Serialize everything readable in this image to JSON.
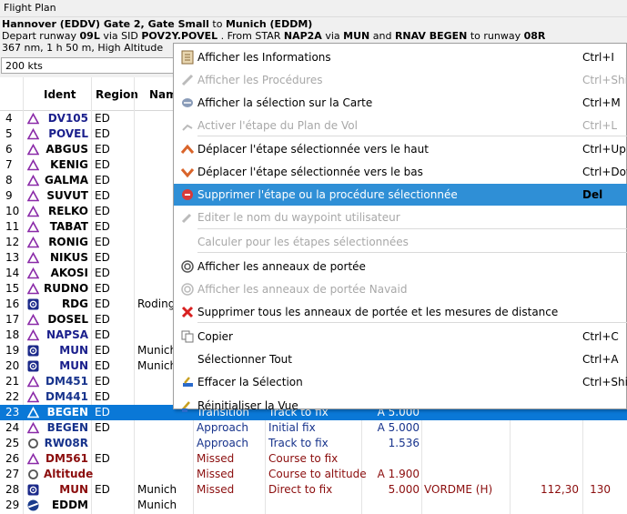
{
  "window": {
    "title": "Flight Plan"
  },
  "info": {
    "line1_from": "Hannover (EDDV) Gate 2, Gate Small",
    "line1_to_word": "to",
    "line1_to": "Munich (EDDM)",
    "line2_a": "Depart runway ",
    "line2_rw": "09L",
    "line2_b": " via SID ",
    "line2_sid": "POV2Y.POVEL",
    "line2_c": " . From STAR ",
    "line2_star": "NAP2A",
    "line2_d": " via ",
    "line2_via": "MUN",
    "line2_e": " and ",
    "line2_rnav": "RNAV BEGEN",
    "line2_f": " to runway ",
    "line2_rw2": "08R",
    "line3": "367 nm, 1 h 50 m, High Altitude"
  },
  "speed": {
    "value": "200 kts"
  },
  "table": {
    "headers": {
      "ident": "Ident",
      "region": "Region",
      "name": "Nam"
    },
    "rows": [
      {
        "num": "4",
        "icon": "triangle",
        "ident": "DV105",
        "region": "ED",
        "name": "",
        "proc": "",
        "leg": "",
        "alt": "",
        "rest": "",
        "crs": "",
        "dst": "",
        "c": "navy"
      },
      {
        "num": "5",
        "icon": "triangle",
        "ident": "POVEL",
        "region": "ED",
        "name": "",
        "proc": "",
        "leg": "",
        "alt": "",
        "rest": "",
        "crs": "",
        "dst": "",
        "c": "navy"
      },
      {
        "num": "6",
        "icon": "triangle",
        "ident": "ABGUS",
        "region": "ED",
        "name": "",
        "proc": "",
        "leg": "",
        "alt": "",
        "rest": "",
        "crs": "",
        "dst": "",
        "c": ""
      },
      {
        "num": "7",
        "icon": "triangle",
        "ident": "KENIG",
        "region": "ED",
        "name": "",
        "proc": "",
        "leg": "",
        "alt": "",
        "rest": "",
        "crs": "",
        "dst": "",
        "c": ""
      },
      {
        "num": "8",
        "icon": "triangle",
        "ident": "GALMA",
        "region": "ED",
        "name": "",
        "proc": "",
        "leg": "",
        "alt": "",
        "rest": "",
        "crs": "",
        "dst": "",
        "c": ""
      },
      {
        "num": "9",
        "icon": "triangle",
        "ident": "SUVUT",
        "region": "ED",
        "name": "",
        "proc": "",
        "leg": "",
        "alt": "",
        "rest": "",
        "crs": "",
        "dst": "",
        "c": ""
      },
      {
        "num": "10",
        "icon": "triangle",
        "ident": "RELKO",
        "region": "ED",
        "name": "",
        "proc": "",
        "leg": "",
        "alt": "",
        "rest": "",
        "crs": "",
        "dst": "",
        "c": ""
      },
      {
        "num": "11",
        "icon": "triangle",
        "ident": "TABAT",
        "region": "ED",
        "name": "",
        "proc": "",
        "leg": "",
        "alt": "",
        "rest": "",
        "crs": "",
        "dst": "",
        "c": ""
      },
      {
        "num": "12",
        "icon": "triangle",
        "ident": "RONIG",
        "region": "ED",
        "name": "",
        "proc": "",
        "leg": "",
        "alt": "",
        "rest": "",
        "crs": "",
        "dst": "",
        "c": ""
      },
      {
        "num": "13",
        "icon": "triangle",
        "ident": "NIKUS",
        "region": "ED",
        "name": "",
        "proc": "",
        "leg": "",
        "alt": "",
        "rest": "",
        "crs": "",
        "dst": "",
        "c": ""
      },
      {
        "num": "14",
        "icon": "triangle",
        "ident": "AKOSI",
        "region": "ED",
        "name": "",
        "proc": "",
        "leg": "",
        "alt": "",
        "rest": "",
        "crs": "",
        "dst": "",
        "c": ""
      },
      {
        "num": "15",
        "icon": "triangle",
        "ident": "RUDNO",
        "region": "ED",
        "name": "",
        "proc": "",
        "leg": "",
        "alt": "",
        "rest": "",
        "crs": "",
        "dst": "",
        "c": ""
      },
      {
        "num": "16",
        "icon": "vor",
        "ident": "RDG",
        "region": "ED",
        "name": "Roding",
        "proc": "",
        "leg": "",
        "alt": "",
        "rest": "",
        "crs": "",
        "dst": "",
        "c": ""
      },
      {
        "num": "17",
        "icon": "triangle",
        "ident": "DOSEL",
        "region": "ED",
        "name": "",
        "proc": "",
        "leg": "",
        "alt": "",
        "rest": "",
        "crs": "",
        "dst": "",
        "c": ""
      },
      {
        "num": "18",
        "icon": "triangle",
        "ident": "NAPSA",
        "region": "ED",
        "name": "",
        "proc": "",
        "leg": "",
        "alt": "",
        "rest": "",
        "crs": "",
        "dst": "",
        "c": "navy"
      },
      {
        "num": "19",
        "icon": "vor",
        "ident": "MUN",
        "region": "ED",
        "name": "Munich",
        "proc": "",
        "leg": "",
        "alt": "",
        "rest": "",
        "crs": "",
        "dst": "",
        "c": "navy"
      },
      {
        "num": "20",
        "icon": "vor",
        "ident": "MUN",
        "region": "ED",
        "name": "Munich",
        "proc": "",
        "leg": "",
        "alt": "",
        "rest": "",
        "crs": "",
        "dst": "",
        "c": "navy"
      },
      {
        "num": "21",
        "icon": "triangle",
        "ident": "DM451",
        "region": "ED",
        "name": "",
        "proc": "",
        "leg": "",
        "alt": "",
        "rest": "",
        "crs": "",
        "dst": "",
        "c": "blue2"
      },
      {
        "num": "22",
        "icon": "triangle",
        "ident": "DM441",
        "region": "ED",
        "name": "",
        "proc": "",
        "leg": "",
        "alt": "",
        "rest": "",
        "crs": "",
        "dst": "",
        "c": "blue2"
      },
      {
        "num": "23",
        "icon": "triangle",
        "ident": "BEGEN",
        "region": "ED",
        "name": "",
        "proc": "Transition",
        "leg": "Track to fix",
        "alt": "A 5.000",
        "rest": "",
        "crs": "",
        "dst": "",
        "c": "blue2",
        "sel": true
      },
      {
        "num": "24",
        "icon": "triangle",
        "ident": "BEGEN",
        "region": "ED",
        "name": "",
        "proc": "Approach",
        "leg": "Initial fix",
        "alt": "A 5.000",
        "rest": "",
        "crs": "",
        "dst": "",
        "c": "blue2"
      },
      {
        "num": "25",
        "icon": "circle",
        "ident": "RW08R",
        "region": "",
        "name": "",
        "proc": "Approach",
        "leg": "Track to fix",
        "alt": "1.536",
        "rest": "",
        "crs": "",
        "dst": "",
        "c": "blue2"
      },
      {
        "num": "26",
        "icon": "triangle",
        "ident": "DM561",
        "region": "ED",
        "name": "",
        "proc": "Missed",
        "leg": "Course to fix",
        "alt": "",
        "rest": "",
        "crs": "",
        "dst": "",
        "c": "maroon"
      },
      {
        "num": "27",
        "icon": "circle",
        "ident": "Altitude",
        "region": "",
        "name": "",
        "proc": "Missed",
        "leg": "Course to altitude",
        "alt": "A 1.900",
        "rest": "",
        "crs": "",
        "dst": "",
        "c": "maroon"
      },
      {
        "num": "28",
        "icon": "vor",
        "ident": "MUN",
        "region": "ED",
        "name": "Munich",
        "proc": "Missed",
        "leg": "Direct to fix",
        "alt": "5.000",
        "rest": "VORDME (H)",
        "crs": "112,30",
        "dst": "130",
        "c": "maroon"
      },
      {
        "num": "29",
        "icon": "airport",
        "ident": "EDDM",
        "region": "",
        "name": "Munich",
        "proc": "",
        "leg": "",
        "alt": "",
        "rest": "",
        "crs": "",
        "dst": "",
        "c": ""
      }
    ]
  },
  "menu": {
    "items": [
      {
        "label": "Afficher les Informations",
        "shortcut": "Ctrl+I",
        "icon": "info-icon",
        "dis": false
      },
      {
        "label": "Afficher les Procédures",
        "shortcut": "Ctrl+Shif",
        "icon": "procedure-icon",
        "dis": true
      },
      {
        "label": "Afficher la sélection sur la Carte",
        "shortcut": "Ctrl+M",
        "icon": "map-icon",
        "dis": false
      },
      {
        "label": "Activer l'étape du Plan de Vol",
        "shortcut": "Ctrl+L",
        "icon": "activate-leg-icon",
        "dis": true
      },
      {
        "label": "Déplacer l'étape sélectionnée vers le haut",
        "shortcut": "Ctrl+Up",
        "icon": "move-up-icon",
        "dis": false
      },
      {
        "label": "Déplacer l'étape sélectionnée vers le bas",
        "shortcut": "Ctrl+Dow",
        "icon": "move-down-icon",
        "dis": false
      },
      {
        "label": "Supprimer l'étape ou la procédure sélectionnée",
        "shortcut": "Del",
        "icon": "delete-icon",
        "dis": false,
        "hl": true
      },
      {
        "label": "Editer le nom du waypoint utilisateur",
        "shortcut": "",
        "icon": "edit-waypoint-icon",
        "dis": true
      },
      {
        "label": "Calculer pour les étapes sélectionnées",
        "shortcut": "",
        "icon": "",
        "dis": true
      },
      {
        "label": "Afficher les anneaux de portée",
        "shortcut": "",
        "icon": "range-rings-icon",
        "dis": false
      },
      {
        "label": "Afficher les anneaux de portée Navaid",
        "shortcut": "",
        "icon": "navaid-rings-icon",
        "dis": true
      },
      {
        "label": "Supprimer tous les anneaux de portée et les mesures de distance",
        "shortcut": "",
        "icon": "remove-rings-icon",
        "dis": false
      },
      {
        "label": "Copier",
        "shortcut": "Ctrl+C",
        "icon": "copy-icon",
        "dis": false
      },
      {
        "label": "Sélectionner Tout",
        "shortcut": "Ctrl+A",
        "icon": "",
        "dis": false
      },
      {
        "label": "Effacer la Sélection",
        "shortcut": "Ctrl+Shif",
        "icon": "clear-selection-icon",
        "dis": false
      },
      {
        "label": "Réinitialiser la Vue",
        "shortcut": "",
        "icon": "reset-view-icon",
        "dis": false
      }
    ]
  },
  "colors": {
    "selection": "#0a78d7",
    "menu_highlight": "#2f8fd6",
    "navy": "#1a1f8c",
    "maroon": "#8b0d0d"
  }
}
